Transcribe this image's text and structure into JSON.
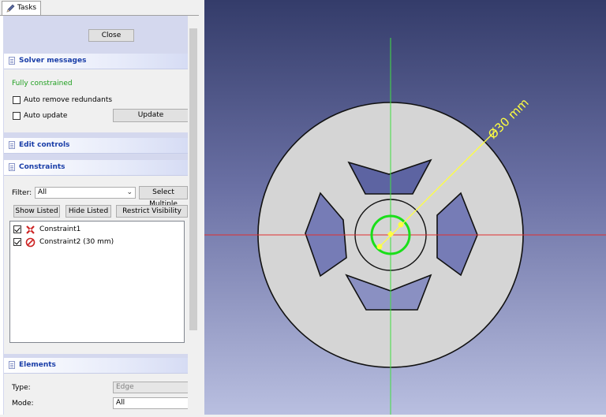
{
  "tab": {
    "label": "Tasks"
  },
  "close_button": "Close",
  "solver": {
    "title": "Solver messages",
    "status": "Fully constrained",
    "status_color": "#1e9e1e",
    "auto_remove_label": "Auto remove redundants",
    "auto_remove_checked": false,
    "auto_update_label": "Auto update",
    "auto_update_checked": false,
    "update_button": "Update"
  },
  "edit_controls": {
    "title": "Edit controls"
  },
  "constraints": {
    "title": "Constraints",
    "filter_label": "Filter:",
    "filter_value": "All",
    "select_multiple_button": "Select Multiple",
    "show_listed_button": "Show Listed",
    "hide_listed_button": "Hide Listed",
    "restrict_visibility_button": "Restrict Visibility",
    "items": [
      {
        "label": "Constraint1",
        "checked": true,
        "icon": "coincident-constraint-icon"
      },
      {
        "label": "Constraint2 (30 mm)",
        "checked": true,
        "icon": "diameter-constraint-icon"
      }
    ]
  },
  "elements": {
    "title": "Elements",
    "type_label": "Type:",
    "type_value": "Edge",
    "mode_label": "Mode:",
    "mode_value": "All"
  },
  "viewport": {
    "dimension_label": "Ø30 mm",
    "colors": {
      "background_top": "#343c6a",
      "background_bottom": "#b9bfe0",
      "part_fill": "#d5d5d5",
      "x_axis": "#e03030",
      "y_axis": "#40e040",
      "constraint_circle": "#1adf1a",
      "dimension": "#ffff40"
    }
  }
}
